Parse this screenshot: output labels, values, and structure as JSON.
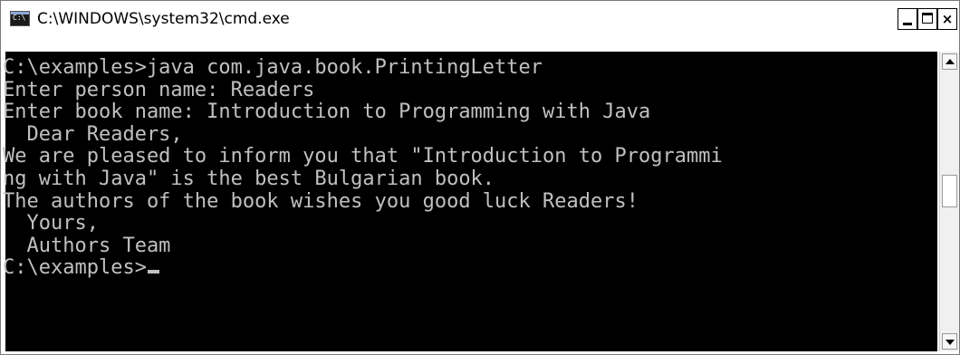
{
  "window": {
    "title": "C:\\WINDOWS\\system32\\cmd.exe",
    "icon": "console-app-icon",
    "icon_text": "C:\\",
    "colors": {
      "console_background": "#000000",
      "console_text": "#c0c0c0",
      "titlebar_background": "#ffffff"
    }
  },
  "console": {
    "lines": [
      "C:\\examples>java com.java.book.PrintingLetter",
      "Enter person name: Readers",
      "Enter book name: Introduction to Programming with Java",
      "  Dear Readers,",
      "We are pleased to inform you that \"Introduction to Programmi",
      "ng with Java\" is the best Bulgarian book.",
      "The authors of the book wishes you good luck Readers!",
      "  Yours,",
      "  Authors Team"
    ],
    "prompt": "C:\\examples>"
  },
  "scrollbar": {
    "up_icon": "scroll-up-arrow-icon",
    "down_icon": "scroll-down-arrow-icon"
  }
}
